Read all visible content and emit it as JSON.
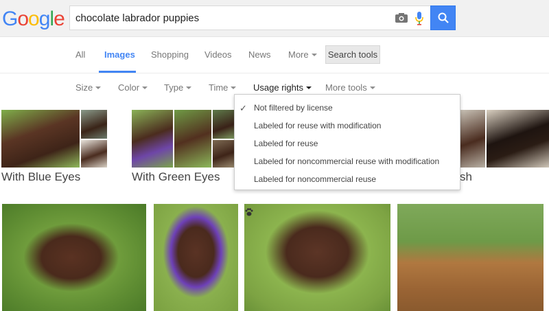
{
  "logo": {
    "text": "Google"
  },
  "search": {
    "value": "chocolate labrador puppies"
  },
  "icons": {
    "camera": "camera-icon",
    "mic": "microphone-icon",
    "search": "search-icon",
    "check": "checkmark-icon",
    "paw": "paw-icon"
  },
  "tabs": [
    {
      "label": "All"
    },
    {
      "label": "Images"
    },
    {
      "label": "Shopping"
    },
    {
      "label": "Videos"
    },
    {
      "label": "News"
    },
    {
      "label": "More"
    }
  ],
  "search_tools_label": "Search tools",
  "filters": [
    {
      "label": "Size"
    },
    {
      "label": "Color"
    },
    {
      "label": "Type"
    },
    {
      "label": "Time"
    },
    {
      "label": "Usage rights"
    },
    {
      "label": "More tools"
    }
  ],
  "usage_rights_menu": {
    "selected": "Not filtered by license",
    "items": [
      {
        "label": "Not filtered by license"
      },
      {
        "label": "Labeled for reuse with modification"
      },
      {
        "label": "Labeled for reuse"
      },
      {
        "label": "Labeled for noncommercial reuse with modification"
      },
      {
        "label": "Labeled for noncommercial reuse"
      }
    ]
  },
  "related": [
    {
      "label": "With Blue Eyes"
    },
    {
      "label": "With Green Eyes"
    },
    {
      "label": "sh"
    }
  ],
  "colors": {
    "accent": "#4285f4",
    "topbar": "#f1f1f1"
  }
}
